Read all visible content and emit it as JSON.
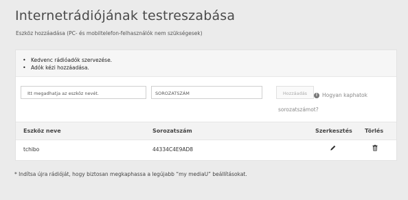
{
  "page": {
    "title": "Internetrádiójának testreszabása",
    "subtitle": "Eszköz hozzáadása (PC- és mobiltelefon-felhasználók nem szükségesek)"
  },
  "instructions": [
    "Kedvenc rádióadók szervezése.",
    "Adók kézi hozzáadása."
  ],
  "form": {
    "device_name_placeholder": "Itt megadhatja az eszköz nevét.",
    "serial_placeholder": "SOROZATSZÁM",
    "add_button": "Hozzáadás",
    "help_text_line1": "Hogyan kaphatok",
    "help_text_line2": "sorozatszámot?"
  },
  "table": {
    "headers": {
      "name": "Eszköz neve",
      "serial": "Sorozatszám",
      "edit": "Szerkesztés",
      "delete": "Törlés"
    },
    "rows": [
      {
        "name": "tchibo",
        "serial": "44334C4E9AD8"
      }
    ]
  },
  "note": "* Indítsa újra rádióját, hogy biztosan megkaphassa a legújabb “my mediaU” beállításokat.",
  "icons": {
    "help": "info-circle-icon",
    "edit": "pencil-icon",
    "delete": "trash-icon"
  }
}
